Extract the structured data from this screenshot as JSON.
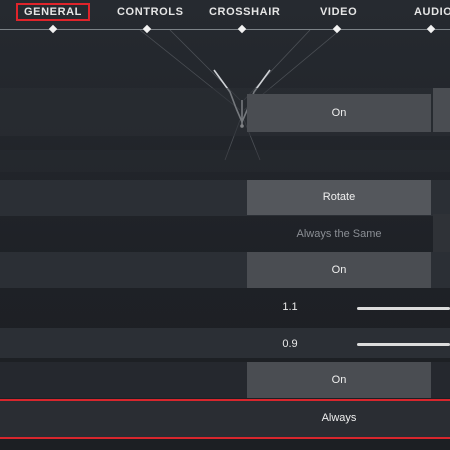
{
  "tabs": [
    {
      "label": "GENERAL",
      "active": true
    },
    {
      "label": "CONTROLS",
      "active": false
    },
    {
      "label": "CROSSHAIR",
      "active": false
    },
    {
      "label": "VIDEO",
      "active": false
    },
    {
      "label": "AUDIO",
      "active": false
    }
  ],
  "settings": {
    "row1_value": "On",
    "row2_value": "Rotate",
    "row3_value": "Always the Same",
    "row4_value": "On",
    "slider1_value": "1.1",
    "slider2_value": "0.9",
    "row7_value": "On",
    "row8_value": "Always"
  },
  "colors": {
    "accent_red": "#e0242b",
    "background": "#202328",
    "button": "#4a4d52"
  }
}
